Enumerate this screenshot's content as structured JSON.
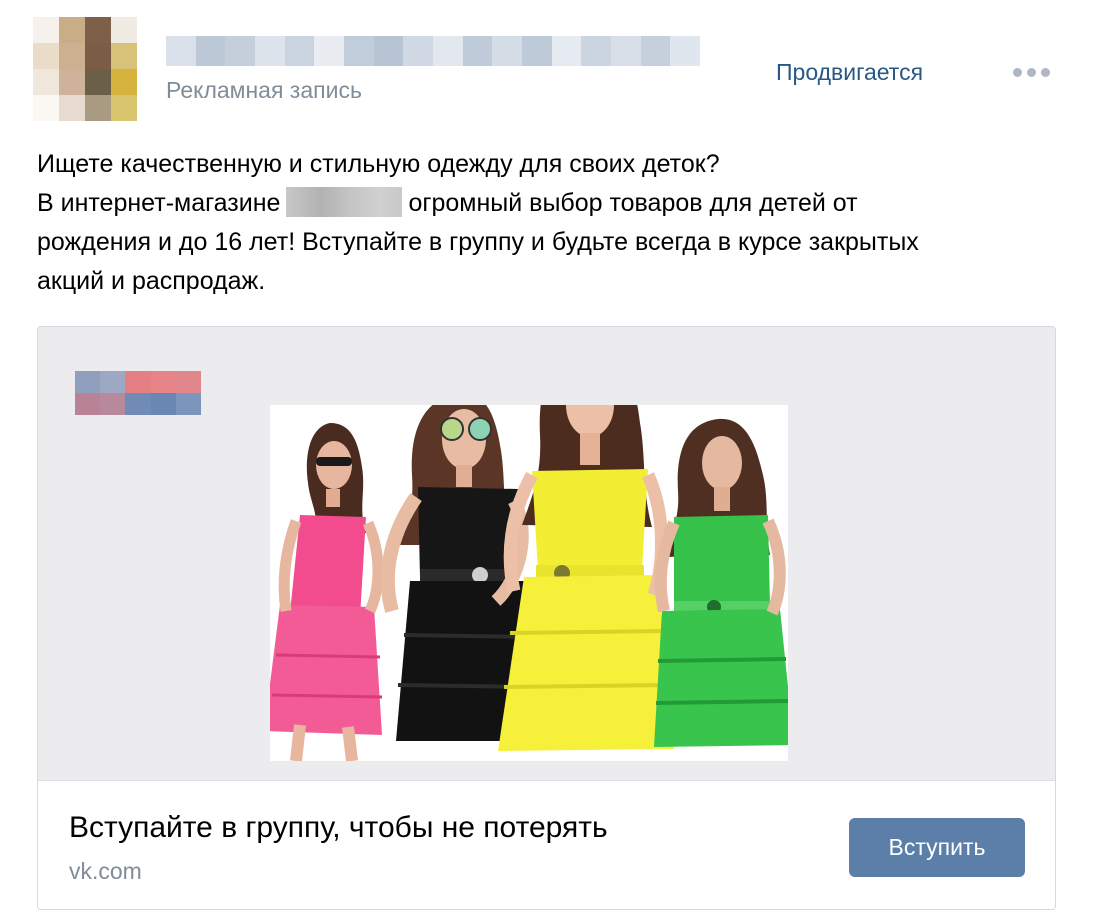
{
  "post": {
    "subtitle": "Рекламная запись",
    "promo_label": "Продвигается",
    "text_line1": "Ищете качественную и стильную одежду для своих деток?",
    "text_line2a": "В интернет-магазине",
    "text_line2b": "огромный выбор товаров для детей от",
    "text_line3": "рождения и до 16 лет! Вступайте в группу и будьте всегда в курсе закрытых",
    "text_line4": "акций и распродаж."
  },
  "card": {
    "cta_title": "Вступайте в группу, чтобы не потерять",
    "domain": "vk.com",
    "join_label": "Вступить"
  },
  "colors": {
    "link": "#2a5885",
    "muted": "#818c99",
    "button": "#5b7fa8",
    "media_bg": "#ecebee"
  },
  "icons": {
    "more": "more-horizontal-icon"
  }
}
